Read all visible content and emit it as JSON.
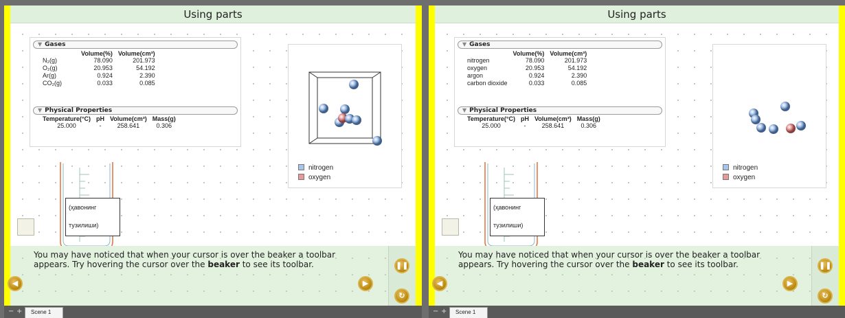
{
  "panels": [
    {
      "title": "Using parts",
      "gases_header": "Gases",
      "gas_columns": [
        "Volume(%)",
        "Volume(cm³)"
      ],
      "gases": [
        {
          "name": "N₂(g)",
          "pct": "78.090",
          "vol": "201.973"
        },
        {
          "name": "O₂(g)",
          "pct": "20.953",
          "vol": "54.192"
        },
        {
          "name": "Ar(g)",
          "pct": "0.924",
          "vol": "2.390"
        },
        {
          "name": "CO₂(g)",
          "pct": "0.033",
          "vol": "0.085"
        }
      ],
      "props_header": "Physical Properties",
      "props_columns": [
        "Temperature(°C)",
        "pH",
        "Volume(cm³)",
        "Mass(g)"
      ],
      "props_values": [
        "25.000",
        "-",
        "258.641",
        "0.306"
      ],
      "legend": [
        {
          "label": "nitrogen",
          "color": "#a8c4ea"
        },
        {
          "label": "oxygen",
          "color": "#e89a9a"
        }
      ],
      "beaker_label": [
        "(ҳавонинг",
        "тузилиши)"
      ],
      "instruction_pre": "You may have noticed that when your cursor is over the beaker a toolbar appears. Try hovering the cursor over the ",
      "instruction_bold": "beaker",
      "instruction_post": " to see its toolbar.",
      "scene_tab": "Scene 1"
    },
    {
      "title": "Using parts",
      "gases_header": "Gases",
      "gas_columns": [
        "Volume(%)",
        "Volume(cm³)"
      ],
      "gases": [
        {
          "name": "nitrogen",
          "pct": "78.090",
          "vol": "201.973"
        },
        {
          "name": "oxygen",
          "pct": "20.953",
          "vol": "54.192"
        },
        {
          "name": "argon",
          "pct": "0.924",
          "vol": "2.390"
        },
        {
          "name": "carbon dioxide",
          "pct": "0.033",
          "vol": "0.085"
        }
      ],
      "props_header": "Physical Properties",
      "props_columns": [
        "Temperature(°C)",
        "pH",
        "Volume(cm³)",
        "Mass(g)"
      ],
      "props_values": [
        "25.000",
        "-",
        "258.641",
        "0.306"
      ],
      "legend": [
        {
          "label": "nitrogen",
          "color": "#a8c4ea"
        },
        {
          "label": "oxygen",
          "color": "#e89a9a"
        }
      ],
      "beaker_label": [
        "(ҳавонинг",
        "тузилиши)"
      ],
      "instruction_pre": "You may have noticed that when your cursor is over the beaker a toolbar appears. Try hovering the cursor over the ",
      "instruction_bold": "beaker",
      "instruction_post": " to see its toolbar.",
      "scene_tab": "Scene 1"
    }
  ],
  "icons": {
    "pause": "pause-icon",
    "back": "arrow-left-icon",
    "next": "arrow-right-icon",
    "reload": "reload-icon"
  },
  "colors": {
    "highlight_yellow": "#ffff00",
    "title_bar": "#dff0dc",
    "button_gold": "#b8860b"
  }
}
